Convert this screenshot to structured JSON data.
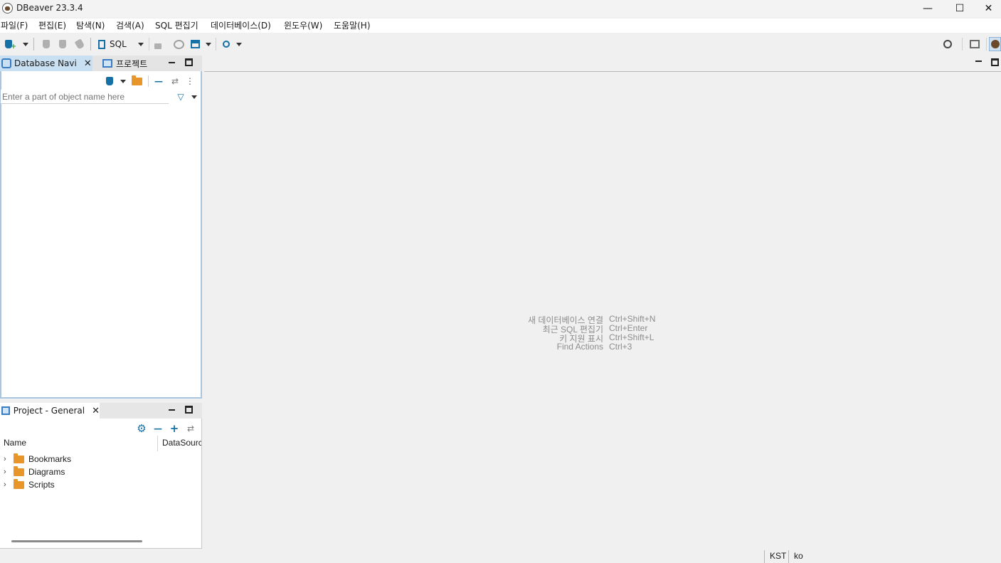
{
  "window": {
    "title": "DBeaver 23.3.4",
    "minimize_glyph": "—",
    "maximize_glyph": "☐",
    "close_glyph": "✕"
  },
  "menu": [
    "파일(F)",
    "편집(E)",
    "탐색(N)",
    "검색(A)",
    "SQL 편집기",
    "데이터베이스(D)",
    "윈도우(W)",
    "도움말(H)"
  ],
  "toolbar": {
    "sql_label": "SQL"
  },
  "navigator": {
    "tab_active": "Database Navi",
    "tab_inactive": "프로젝트",
    "filter_placeholder": "Enter a part of object name here"
  },
  "project": {
    "tab_label": "Project - General",
    "columns": [
      "Name",
      "DataSourc"
    ],
    "items": [
      "Bookmarks",
      "Diagrams",
      "Scripts"
    ]
  },
  "editor_hints": [
    {
      "label": "새 데이터베이스 연결",
      "shortcut": "Ctrl+Shift+N"
    },
    {
      "label": "최근 SQL 편집기",
      "shortcut": "Ctrl+Enter"
    },
    {
      "label": "키 지원 표시",
      "shortcut": "Ctrl+Shift+L"
    },
    {
      "label": "Find Actions",
      "shortcut": "Ctrl+3"
    }
  ],
  "status": {
    "timezone": "KST",
    "locale": "ko"
  },
  "colors": {
    "accent_blue": "#1570a6",
    "active_tab": "#c9dff2",
    "folder_orange": "#e8962a"
  }
}
